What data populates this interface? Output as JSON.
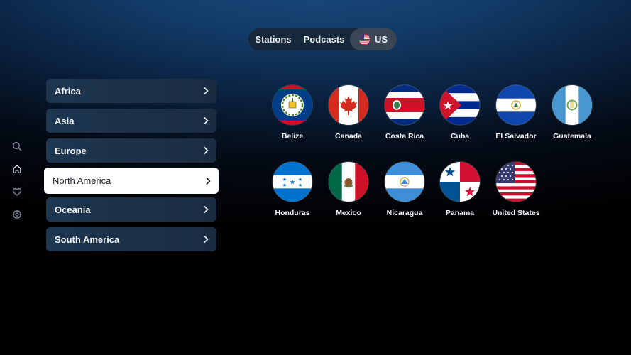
{
  "topnav": {
    "tabs": [
      {
        "label": "Stations"
      },
      {
        "label": "Podcasts"
      },
      {
        "label": "US",
        "flag_icon": "us-flag-icon",
        "selected": true
      }
    ]
  },
  "sidebar": {
    "icons": [
      "search-icon",
      "home-icon",
      "heart-icon",
      "gear-icon"
    ],
    "active": "home-icon"
  },
  "regions": {
    "items": [
      {
        "label": "Africa"
      },
      {
        "label": "Asia"
      },
      {
        "label": "Europe"
      },
      {
        "label": "North America",
        "selected": true
      },
      {
        "label": "Oceania"
      },
      {
        "label": "South America"
      }
    ]
  },
  "countries": {
    "items": [
      {
        "name": "Belize"
      },
      {
        "name": "Canada"
      },
      {
        "name": "Costa Rica"
      },
      {
        "name": "Cuba"
      },
      {
        "name": "El Salvador"
      },
      {
        "name": "Guatemala"
      },
      {
        "name": "Honduras"
      },
      {
        "name": "Mexico"
      },
      {
        "name": "Nicaragua"
      },
      {
        "name": "Panama"
      },
      {
        "name": "United States"
      }
    ]
  },
  "colors": {
    "background_top": "#1b4f86",
    "background_bottom": "#000000",
    "selected_region_bg": "#ffffff",
    "region_bg": "#1d3650",
    "nav_pill_bg": "#17283b",
    "selected_tab_bg": "#3b4654"
  }
}
